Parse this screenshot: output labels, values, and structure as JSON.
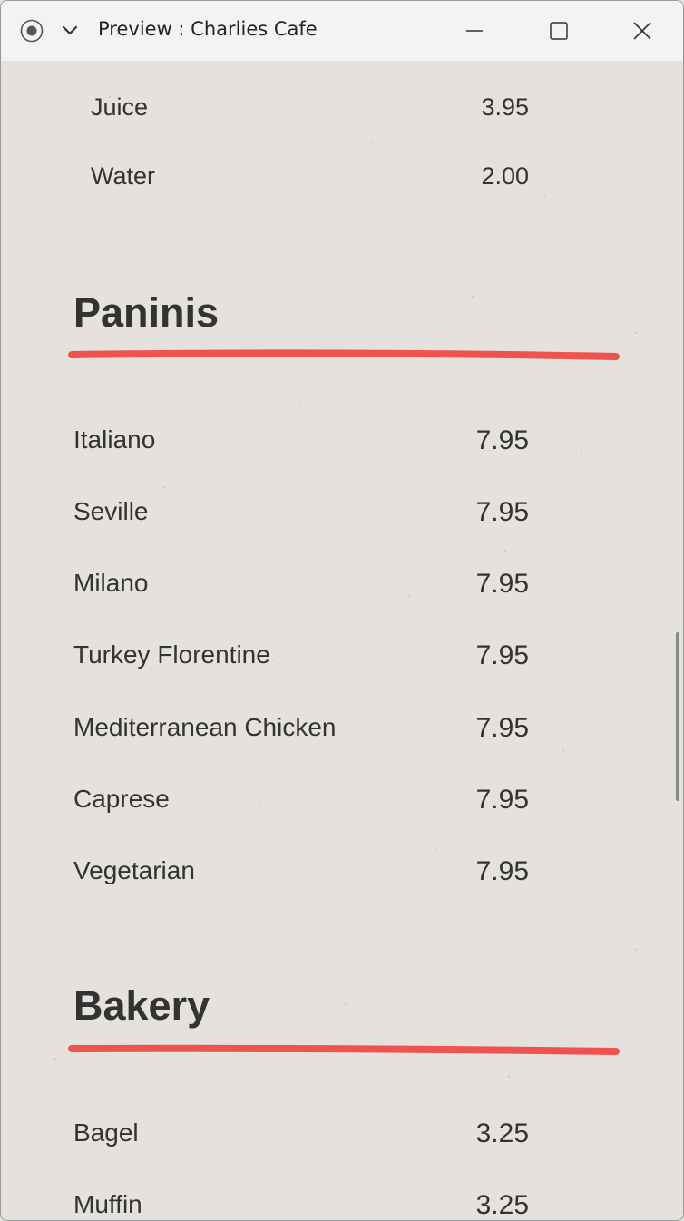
{
  "window": {
    "title": "Preview : Charlies Cafe",
    "icons": {
      "record": "record-icon",
      "dropdown": "chevron-down-icon",
      "minimize": "minimize-icon",
      "maximize": "maximize-icon",
      "close": "close-icon"
    }
  },
  "colors": {
    "accent_underline": "#ef5350",
    "background": "#e5e2dd",
    "text": "#333333"
  },
  "menu": {
    "drinks_items": [
      {
        "name": "Juice",
        "price": "3.95"
      },
      {
        "name": "Water",
        "price": "2.00"
      }
    ],
    "paninis": {
      "title": "Paninis",
      "items": [
        {
          "name": "Italiano",
          "price": "7.95"
        },
        {
          "name": "Seville",
          "price": "7.95"
        },
        {
          "name": "Milano",
          "price": "7.95"
        },
        {
          "name": "Turkey Florentine",
          "price": "7.95"
        },
        {
          "name": "Mediterranean Chicken",
          "price": "7.95"
        },
        {
          "name": "Caprese",
          "price": "7.95"
        },
        {
          "name": "Vegetarian",
          "price": "7.95"
        }
      ]
    },
    "bakery": {
      "title": "Bakery",
      "items": [
        {
          "name": "Bagel",
          "price": "3.25"
        },
        {
          "name": "Muffin",
          "price": "3.25"
        }
      ]
    }
  }
}
